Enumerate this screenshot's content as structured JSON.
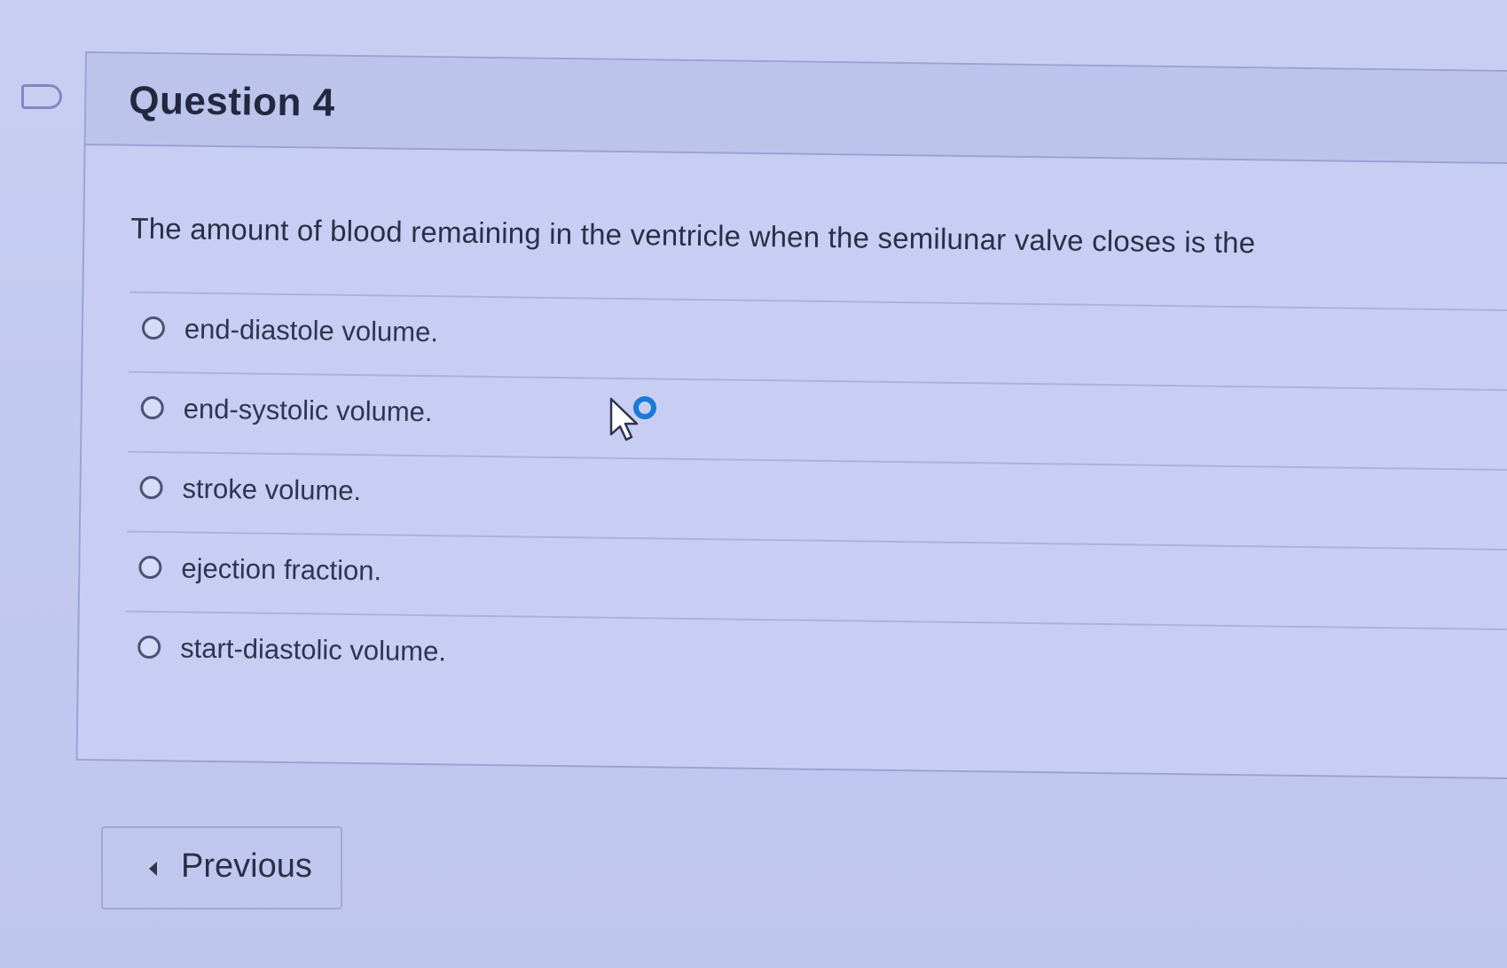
{
  "question": {
    "flag_icon": "flag-icon",
    "title": "Question 4",
    "text": "The amount of blood remaining in the ventricle when the semilunar valve closes is the"
  },
  "answers": [
    {
      "label": "end-diastole volume."
    },
    {
      "label": "end-systolic volume."
    },
    {
      "label": "stroke volume."
    },
    {
      "label": "ejection fraction."
    },
    {
      "label": "start-diastolic volume."
    }
  ],
  "navigation": {
    "previous_label": "Previous",
    "previous_icon": "chevron-left-icon"
  },
  "cursor_icon": "mouse-pointer-busy-icon",
  "colors": {
    "background": "#c5cbf0",
    "accent": "#1a7ad9"
  }
}
